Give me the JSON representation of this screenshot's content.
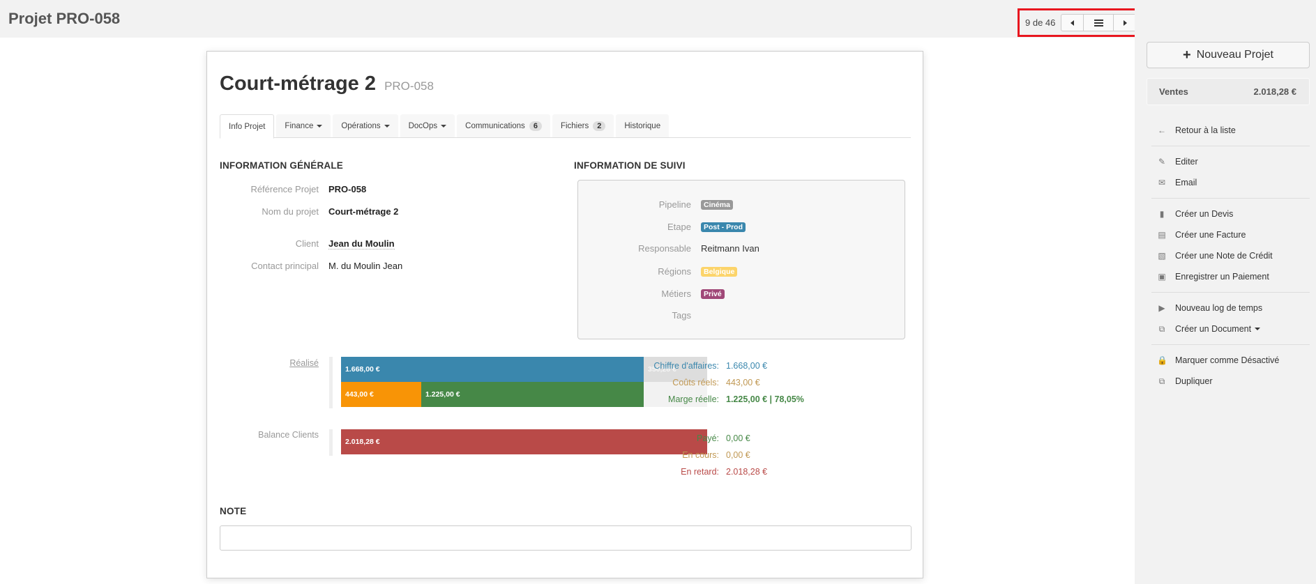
{
  "header": {
    "title": "Projet PRO-058",
    "pager": {
      "count": "9 de 46",
      "prev_icon": "caret-left-icon",
      "list_icon": "list-icon",
      "next_icon": "caret-right-icon"
    },
    "highlight_color": "#e8161f"
  },
  "sidebar": {
    "new_button": {
      "icon": "plus-icon",
      "label": "Nouveau Projet"
    },
    "sales": {
      "label": "Ventes",
      "value": "2.018,28 €"
    },
    "menu_groups": [
      [
        {
          "icon": "arrow-left-icon",
          "label": "Retour à la liste"
        }
      ],
      [
        {
          "icon": "pencil-icon",
          "label": "Editer"
        },
        {
          "icon": "envelope-icon",
          "label": "Email"
        }
      ],
      [
        {
          "icon": "file-icon",
          "label": "Créer un Devis"
        },
        {
          "icon": "file-text-icon",
          "label": "Créer une Facture"
        },
        {
          "icon": "receipt-icon",
          "label": "Créer une Note de Crédit"
        },
        {
          "icon": "credit-card-icon",
          "label": "Enregistrer un Paiement"
        }
      ],
      [
        {
          "icon": "play-icon",
          "label": "Nouveau log de temps"
        },
        {
          "icon": "documents-icon",
          "label": "Créer un Document",
          "dropdown": true
        }
      ],
      [
        {
          "icon": "lock-icon",
          "label": "Marquer comme Désactivé"
        },
        {
          "icon": "duplicate-icon",
          "label": "Dupliquer"
        }
      ]
    ]
  },
  "project": {
    "name": "Court-métrage 2",
    "ref": "PRO-058",
    "tabs": [
      {
        "label": "Info Projet",
        "active": true
      },
      {
        "label": "Finance",
        "dropdown": true
      },
      {
        "label": "Opérations",
        "dropdown": true
      },
      {
        "label": "DocOps",
        "dropdown": true
      },
      {
        "label": "Communications",
        "badge": "6"
      },
      {
        "label": "Fichiers",
        "badge": "2"
      },
      {
        "label": "Historique"
      }
    ],
    "general": {
      "heading": "INFORMATION GÉNÉRALE",
      "rows": [
        {
          "label": "Référence Projet",
          "value": "PRO-058"
        },
        {
          "label": "Nom du projet",
          "value": "Court-métrage 2"
        },
        {
          "label": "Client",
          "value": "Jean du Moulin"
        },
        {
          "label": "Contact principal",
          "value": "M. du Moulin Jean"
        }
      ]
    },
    "suivi": {
      "heading": "INFORMATION DE SUIVI",
      "rows": [
        {
          "label": "Pipeline",
          "tag": "Cinéma",
          "color": "#999999"
        },
        {
          "label": "Etape",
          "tag": "Post - Prod",
          "color": "#3a87ad"
        },
        {
          "label": "Responsable",
          "value": "Reitmann Ivan"
        },
        {
          "label": "Régions",
          "tag": "Belgique",
          "color": "#fcd46a"
        },
        {
          "label": "Métiers",
          "tag": "Privé",
          "color": "#a04878"
        },
        {
          "label": "Tags",
          "value": ""
        }
      ]
    },
    "realise": {
      "label": "Réalisé",
      "total": 2018.28,
      "row1": [
        {
          "name": "chiffre-affaires",
          "label": "1.668,00 €",
          "value": 1668.0,
          "color": "#3a87ad"
        },
        {
          "name": "reste",
          "label": "350,28 €",
          "value": 350.28,
          "color": "#dddddd"
        }
      ],
      "row2": [
        {
          "name": "couts",
          "label": "443,00 €",
          "value": 443.0,
          "color": "#f89406"
        },
        {
          "name": "marge",
          "label": "1.225,00 €",
          "value": 1225.0,
          "color": "#468847"
        },
        {
          "name": "vide",
          "label": "",
          "value": 350.28,
          "color": "#f2f2f2"
        }
      ],
      "stats": [
        {
          "label": "Chiffre d'affaires:",
          "value": "1.668,00 €",
          "color": "#3a87ad",
          "bold": false
        },
        {
          "label": "Coûts réels:",
          "value": "443,00 €",
          "color": "#c09853",
          "bold": false
        },
        {
          "label": "Marge réelle:",
          "value": "1.225,00 € | 78,05%",
          "color": "#468847",
          "bold": true
        }
      ]
    },
    "balance": {
      "label": "Balance Clients",
      "bar": {
        "label": "2.018,28 €",
        "value": 2018.28,
        "color": "#b94a48"
      },
      "stats": [
        {
          "label": "Payé:",
          "value": "0,00 €",
          "color": "#468847"
        },
        {
          "label": "En cours:",
          "value": "0,00 €",
          "color": "#c09853"
        },
        {
          "label": "En retard:",
          "value": "2.018,28 €",
          "color": "#b94a48"
        }
      ]
    },
    "note": {
      "heading": "NOTE",
      "value": ""
    }
  }
}
